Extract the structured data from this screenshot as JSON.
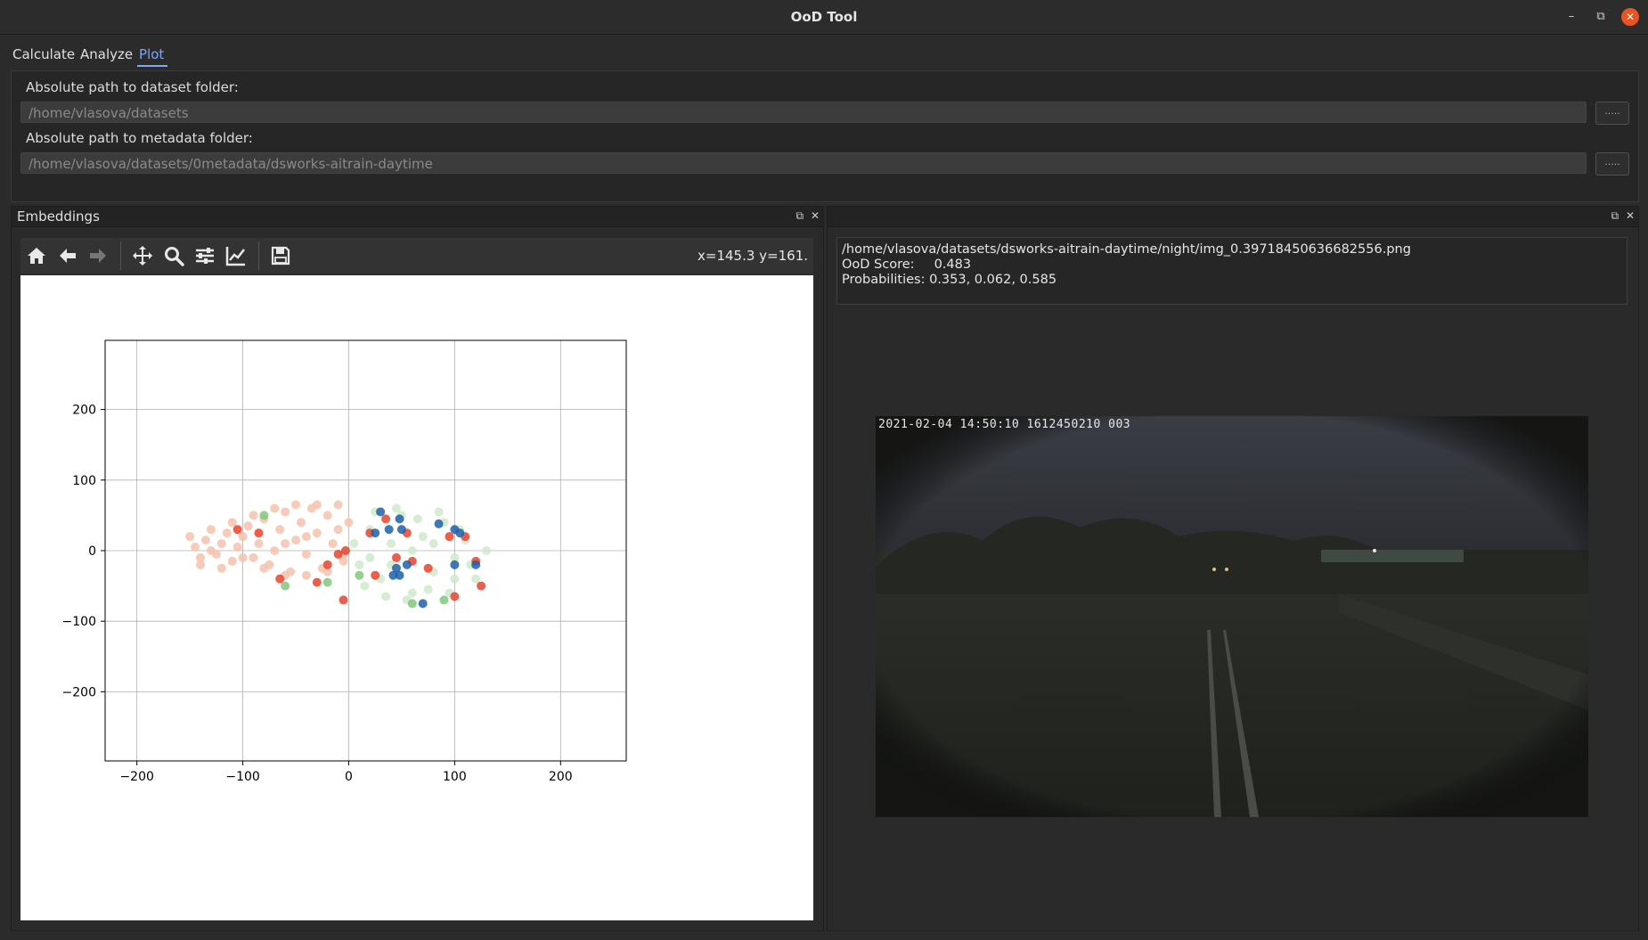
{
  "window": {
    "title": "OoD Tool"
  },
  "tabs": [
    {
      "label": "Calculate"
    },
    {
      "label": "Analyze"
    },
    {
      "label": "Plot"
    }
  ],
  "paths": {
    "dataset_label": "Absolute path to dataset folder:",
    "dataset_value": "/home/vlasova/datasets",
    "metadata_label": "Absolute path to metadata folder:",
    "metadata_value": "/home/vlasova/datasets/0metadata/dsworks-aitrain-daytime",
    "browse_label": "....."
  },
  "embeddings": {
    "title": "Embeddings",
    "coords": "x=145.3 y=161.",
    "toolbar_icons": [
      "home-icon",
      "back-icon",
      "forward-icon",
      "pan-icon",
      "zoom-icon",
      "configure-subplots-icon",
      "edit-axis-icon",
      "save-icon"
    ]
  },
  "details": {
    "path": "/home/vlasova/datasets/dsworks-aitrain-daytime/night/img_0.39718450636682556.png",
    "score_label": "OoD Score:",
    "score_value": "0.483",
    "probabilities_label": "Probabilities:",
    "probabilities_value": "0.353, 0.062, 0.585",
    "image_stamp": "2021-02-04 14:50:10 1612450210 003"
  },
  "colors": {
    "accent": "#7da7f5",
    "close": "#e95420",
    "red": "#e8432d",
    "blue": "#1f5fa8",
    "green": "#bfe3b8",
    "light_red": "#f6c2ad"
  },
  "chart_data": {
    "type": "scatter",
    "xlim": [
      -230,
      262
    ],
    "ylim": [
      -298,
      298
    ],
    "xticks": [
      -200,
      -100,
      0,
      100,
      200
    ],
    "yticks": [
      -200,
      -100,
      0,
      100,
      200
    ],
    "tick_labels_x": [
      "−200",
      "−100",
      "0",
      "100",
      "200"
    ],
    "tick_labels_y": [
      "−200",
      "−100",
      "0",
      "100",
      "200"
    ],
    "grid": true,
    "series": [
      {
        "color": "#f6c2ad",
        "points": [
          [
            -150,
            20
          ],
          [
            -145,
            5
          ],
          [
            -140,
            -10
          ],
          [
            -135,
            15
          ],
          [
            -130,
            30
          ],
          [
            -125,
            -5
          ],
          [
            -120,
            10
          ],
          [
            -115,
            25
          ],
          [
            -110,
            -15
          ],
          [
            -105,
            5
          ],
          [
            -100,
            20
          ],
          [
            -95,
            35
          ],
          [
            -90,
            -10
          ],
          [
            -85,
            10
          ],
          [
            -80,
            45
          ],
          [
            -75,
            -20
          ],
          [
            -70,
            0
          ],
          [
            -65,
            30
          ],
          [
            -60,
            55
          ],
          [
            -55,
            -30
          ],
          [
            -50,
            15
          ],
          [
            -45,
            40
          ],
          [
            -40,
            -5
          ],
          [
            -35,
            60
          ],
          [
            -30,
            25
          ],
          [
            -25,
            -25
          ],
          [
            -20,
            50
          ],
          [
            -15,
            10
          ],
          [
            -10,
            65
          ],
          [
            -5,
            -15
          ],
          [
            0,
            40
          ],
          [
            -140,
            -20
          ],
          [
            -120,
            -25
          ],
          [
            -100,
            -10
          ],
          [
            -80,
            -25
          ],
          [
            -60,
            -35
          ],
          [
            -40,
            -35
          ],
          [
            -20,
            -30
          ],
          [
            -130,
            0
          ],
          [
            -110,
            40
          ],
          [
            -90,
            50
          ],
          [
            -70,
            60
          ],
          [
            -50,
            65
          ],
          [
            -30,
            65
          ],
          [
            -10,
            30
          ],
          [
            -5,
            -5
          ],
          [
            -60,
            10
          ],
          [
            -40,
            20
          ]
        ]
      },
      {
        "color": "#cfeacb",
        "points": [
          [
            10,
            -20
          ],
          [
            20,
            30
          ],
          [
            30,
            -40
          ],
          [
            40,
            10
          ],
          [
            50,
            50
          ],
          [
            60,
            -60
          ],
          [
            70,
            20
          ],
          [
            80,
            -30
          ],
          [
            90,
            40
          ],
          [
            100,
            -10
          ],
          [
            110,
            15
          ],
          [
            120,
            -40
          ],
          [
            130,
            0
          ],
          [
            15,
            -50
          ],
          [
            35,
            -65
          ],
          [
            55,
            -70
          ],
          [
            75,
            -55
          ],
          [
            95,
            -60
          ],
          [
            25,
            55
          ],
          [
            45,
            60
          ],
          [
            65,
            45
          ],
          [
            85,
            55
          ],
          [
            105,
            30
          ],
          [
            115,
            -20
          ],
          [
            20,
            -10
          ],
          [
            40,
            -20
          ],
          [
            60,
            0
          ],
          [
            80,
            10
          ],
          [
            100,
            -40
          ],
          [
            5,
            10
          ]
        ]
      },
      {
        "color": "#7fc97a",
        "points": [
          [
            -80,
            50
          ],
          [
            -60,
            -50
          ],
          [
            -20,
            -45
          ],
          [
            10,
            -35
          ],
          [
            60,
            -75
          ],
          [
            90,
            -70
          ]
        ]
      },
      {
        "color": "#e8432d",
        "points": [
          [
            -105,
            30
          ],
          [
            -85,
            25
          ],
          [
            -65,
            -40
          ],
          [
            -30,
            -45
          ],
          [
            -10,
            -5
          ],
          [
            -5,
            -70
          ],
          [
            20,
            25
          ],
          [
            25,
            -35
          ],
          [
            35,
            45
          ],
          [
            45,
            -10
          ],
          [
            55,
            25
          ],
          [
            60,
            -15
          ],
          [
            75,
            -25
          ],
          [
            95,
            20
          ],
          [
            100,
            -65
          ],
          [
            110,
            20
          ],
          [
            120,
            -15
          ],
          [
            125,
            -50
          ],
          [
            -20,
            -20
          ],
          [
            -3,
            0
          ]
        ]
      },
      {
        "color": "#1f5fa8",
        "points": [
          [
            25,
            25
          ],
          [
            30,
            55
          ],
          [
            38,
            30
          ],
          [
            48,
            45
          ],
          [
            50,
            30
          ],
          [
            45,
            -25
          ],
          [
            42,
            -35
          ],
          [
            48,
            -35
          ],
          [
            55,
            -20
          ],
          [
            70,
            -75
          ],
          [
            85,
            38
          ],
          [
            100,
            -20
          ],
          [
            100,
            30
          ],
          [
            105,
            25
          ],
          [
            120,
            -20
          ]
        ]
      }
    ]
  }
}
